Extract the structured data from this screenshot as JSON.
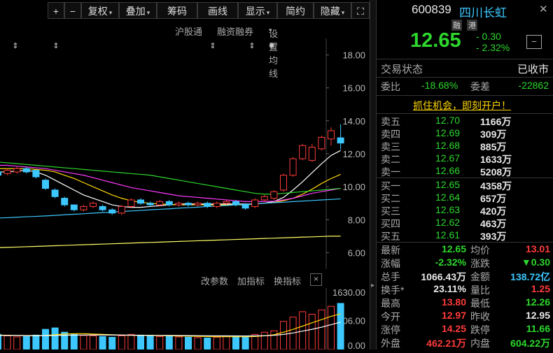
{
  "toolbar": {
    "plus": "+",
    "minus": "−",
    "fuquan": "复权",
    "diejia": "叠加",
    "chouma": "筹码",
    "huaxian": "画线",
    "xianshi": "显示",
    "jianyue": "简约",
    "yincang": "隐藏",
    "expand": "⛶"
  },
  "subbar": {
    "hugutong": "沪股通",
    "rongzi": "融资融券",
    "set_ma": "设置均线"
  },
  "price_axis": [
    "18.00",
    "16.00",
    "14.00",
    "12.00",
    "10.00",
    "8.00",
    "6.00"
  ],
  "volume_toolbar": {
    "change_params": "改参数",
    "add_indicator": "加指标",
    "switch_indicator": "换指标",
    "close": "×"
  },
  "volume_axis": [
    "1630.00",
    "806.00",
    "0.00"
  ],
  "quote": {
    "code": "600839",
    "name": "四川长虹",
    "badge_rong": "融",
    "badge_gang": "港",
    "price": "12.65",
    "change": "- 0.30",
    "change_pct": "- 2.32%",
    "minimize": "−"
  },
  "status": {
    "label": "交易状态",
    "value": "已收市"
  },
  "weibi": {
    "label": "委比",
    "value": "-18.68%",
    "cha_label": "委差",
    "cha_value": "-22862"
  },
  "promo": "抓住机会，即刻开户！",
  "asks": [
    {
      "label": "卖五",
      "price": "12.70",
      "vol": "1166万"
    },
    {
      "label": "卖四",
      "price": "12.69",
      "vol": "309万"
    },
    {
      "label": "卖三",
      "price": "12.68",
      "vol": "885万"
    },
    {
      "label": "卖二",
      "price": "12.67",
      "vol": "1633万"
    },
    {
      "label": "卖一",
      "price": "12.66",
      "vol": "5208万"
    }
  ],
  "bids": [
    {
      "label": "买一",
      "price": "12.65",
      "vol": "4358万"
    },
    {
      "label": "买二",
      "price": "12.64",
      "vol": "657万"
    },
    {
      "label": "买三",
      "price": "12.63",
      "vol": "420万"
    },
    {
      "label": "买四",
      "price": "12.62",
      "vol": "463万"
    },
    {
      "label": "买五",
      "price": "12.61",
      "vol": "393万"
    }
  ],
  "stats": [
    {
      "l1": "最新",
      "v1": "12.65",
      "c1": "green",
      "l2": "均价",
      "v2": "13.01",
      "c2": "red"
    },
    {
      "l1": "涨幅",
      "v1": "-2.32%",
      "c1": "green",
      "l2": "涨跌",
      "v2": "▼0.30",
      "c2": "green"
    },
    {
      "l1": "总手",
      "v1": "1066.43万",
      "c1": "white",
      "l2": "金额",
      "v2": "138.72亿",
      "c2": "cyan"
    },
    {
      "l1": "换手*",
      "v1": "23.11%",
      "c1": "white",
      "l2": "量比",
      "v2": "1.25",
      "c2": "red"
    },
    {
      "l1": "最高",
      "v1": "13.80",
      "c1": "red",
      "l2": "最低",
      "v2": "12.26",
      "c2": "green"
    },
    {
      "l1": "今开",
      "v1": "12.97",
      "c1": "red",
      "l2": "昨收",
      "v2": "12.95",
      "c2": "white"
    },
    {
      "l1": "涨停",
      "v1": "14.25",
      "c1": "red",
      "l2": "跌停",
      "v2": "11.66",
      "c2": "green"
    },
    {
      "l1": "外盘",
      "v1": "462.21万",
      "c1": "red",
      "l2": "内盘",
      "v2": "604.22万",
      "c2": "green"
    }
  ],
  "chart_data": {
    "type": "candlestick",
    "ylim": [
      5.0,
      19.0
    ],
    "candles": [
      {
        "o": 10.9,
        "c": 10.7,
        "h": 11.0,
        "l": 10.4
      },
      {
        "o": 10.8,
        "c": 11.0,
        "h": 11.1,
        "l": 10.7
      },
      {
        "o": 10.9,
        "c": 11.1,
        "h": 11.2,
        "l": 10.8
      },
      {
        "o": 11.1,
        "c": 10.9,
        "h": 11.2,
        "l": 10.8
      },
      {
        "o": 11.0,
        "c": 10.6,
        "h": 11.0,
        "l": 10.5
      },
      {
        "o": 10.4,
        "c": 9.9,
        "h": 10.5,
        "l": 9.8
      },
      {
        "o": 9.8,
        "c": 9.4,
        "h": 9.9,
        "l": 9.3
      },
      {
        "o": 9.3,
        "c": 8.9,
        "h": 9.4,
        "l": 8.8
      },
      {
        "o": 8.9,
        "c": 8.6,
        "h": 8.9,
        "l": 8.5
      },
      {
        "o": 8.6,
        "c": 8.8,
        "h": 8.9,
        "l": 8.5
      },
      {
        "o": 8.8,
        "c": 9.0,
        "h": 9.1,
        "l": 8.7
      },
      {
        "o": 8.8,
        "c": 8.6,
        "h": 8.9,
        "l": 8.5
      },
      {
        "o": 8.6,
        "c": 8.4,
        "h": 8.7,
        "l": 8.3
      },
      {
        "o": 8.4,
        "c": 8.8,
        "h": 8.9,
        "l": 8.3
      },
      {
        "o": 8.8,
        "c": 9.2,
        "h": 9.3,
        "l": 8.7
      },
      {
        "o": 9.2,
        "c": 9.0,
        "h": 9.3,
        "l": 8.9
      },
      {
        "o": 9.0,
        "c": 8.9,
        "h": 9.1,
        "l": 8.8
      },
      {
        "o": 8.9,
        "c": 9.1,
        "h": 9.2,
        "l": 8.8
      },
      {
        "o": 9.1,
        "c": 8.9,
        "h": 9.2,
        "l": 8.8
      },
      {
        "o": 8.9,
        "c": 9.0,
        "h": 9.1,
        "l": 8.8
      },
      {
        "o": 9.0,
        "c": 8.9,
        "h": 9.1,
        "l": 8.8
      },
      {
        "o": 8.9,
        "c": 9.0,
        "h": 9.1,
        "l": 8.8
      },
      {
        "o": 9.0,
        "c": 8.8,
        "h": 9.1,
        "l": 8.7
      },
      {
        "o": 8.8,
        "c": 9.0,
        "h": 9.1,
        "l": 8.7
      },
      {
        "o": 9.0,
        "c": 9.1,
        "h": 9.2,
        "l": 8.9
      },
      {
        "o": 9.1,
        "c": 8.9,
        "h": 9.2,
        "l": 8.8
      },
      {
        "o": 8.9,
        "c": 8.7,
        "h": 9.0,
        "l": 8.6
      },
      {
        "o": 8.8,
        "c": 9.2,
        "h": 9.3,
        "l": 8.7
      },
      {
        "o": 9.2,
        "c": 9.4,
        "h": 9.5,
        "l": 9.1
      },
      {
        "o": 9.3,
        "c": 9.7,
        "h": 9.8,
        "l": 9.2
      },
      {
        "o": 9.8,
        "c": 10.7,
        "h": 10.8,
        "l": 9.7
      },
      {
        "o": 10.7,
        "c": 11.7,
        "h": 11.8,
        "l": 10.6
      },
      {
        "o": 11.7,
        "c": 12.5,
        "h": 12.6,
        "l": 11.6
      },
      {
        "o": 11.6,
        "c": 12.4,
        "h": 12.6,
        "l": 11.5
      },
      {
        "o": 12.3,
        "c": 13.0,
        "h": 13.1,
        "l": 12.2
      },
      {
        "o": 12.9,
        "c": 13.4,
        "h": 13.6,
        "l": 12.5
      },
      {
        "o": 12.97,
        "c": 12.65,
        "h": 13.8,
        "l": 12.26
      }
    ],
    "ma": [
      {
        "color": "#ffffff",
        "values": [
          10.9,
          10.9,
          10.95,
          11.0,
          10.9,
          10.7,
          10.4,
          10.1,
          9.8,
          9.5,
          9.3,
          9.1,
          8.9,
          8.8,
          8.75,
          8.75,
          8.8,
          8.85,
          8.9,
          8.95,
          8.95,
          8.95,
          8.95,
          8.95,
          8.95,
          8.95,
          8.95,
          8.95,
          9.0,
          9.1,
          9.35,
          9.8,
          10.3,
          10.85,
          11.4,
          11.9,
          12.2
        ]
      },
      {
        "color": "#ffd700",
        "values": [
          11.1,
          11.1,
          11.1,
          11.1,
          11.05,
          11.0,
          10.9,
          10.7,
          10.5,
          10.25,
          10.0,
          9.75,
          9.5,
          9.3,
          9.15,
          9.05,
          9.0,
          8.95,
          8.92,
          8.9,
          8.9,
          8.9,
          8.9,
          8.9,
          8.9,
          8.9,
          8.9,
          8.95,
          9.0,
          9.05,
          9.15,
          9.3,
          9.55,
          9.85,
          10.2,
          10.5,
          10.75
        ]
      },
      {
        "color": "#ff3bff",
        "values": [
          11.3,
          11.3,
          11.25,
          11.2,
          11.15,
          11.1,
          11.0,
          10.9,
          10.8,
          10.7,
          10.55,
          10.4,
          10.25,
          10.1,
          9.95,
          9.85,
          9.75,
          9.65,
          9.55,
          9.45,
          9.4,
          9.35,
          9.3,
          9.25,
          9.2,
          9.15,
          9.1,
          9.1,
          9.1,
          9.12,
          9.2,
          9.3,
          9.45,
          9.6,
          9.7,
          9.8,
          9.9
        ]
      },
      {
        "color": "#2dd82d",
        "values": [
          11.5,
          11.45,
          11.4,
          11.35,
          11.3,
          11.25,
          11.2,
          11.15,
          11.1,
          11.05,
          11.0,
          10.95,
          10.9,
          10.85,
          10.8,
          10.75,
          10.7,
          10.6,
          10.5,
          10.4,
          10.3,
          10.2,
          10.1,
          10.0,
          9.9,
          9.8,
          9.7,
          9.6,
          9.55,
          9.55,
          9.6,
          9.65,
          9.7,
          9.75,
          9.8,
          9.85,
          9.9
        ]
      },
      {
        "color": "#3cc8ff",
        "values": [
          8.1,
          8.12,
          8.15,
          8.18,
          8.2,
          8.23,
          8.26,
          8.3,
          8.33,
          8.36,
          8.4,
          8.43,
          8.46,
          8.5,
          8.53,
          8.56,
          8.6,
          8.63,
          8.66,
          8.7,
          8.73,
          8.76,
          8.8,
          8.83,
          8.86,
          8.9,
          8.93,
          8.96,
          9.0,
          9.03,
          9.06,
          9.1,
          9.13,
          9.16,
          9.2,
          9.23,
          9.26
        ]
      },
      {
        "color": "#ffff66",
        "values": [
          6.3,
          6.32,
          6.34,
          6.36,
          6.38,
          6.4,
          6.42,
          6.44,
          6.46,
          6.48,
          6.5,
          6.52,
          6.54,
          6.56,
          6.58,
          6.6,
          6.62,
          6.64,
          6.66,
          6.68,
          6.7,
          6.72,
          6.74,
          6.76,
          6.78,
          6.8,
          6.82,
          6.84,
          6.86,
          6.88,
          6.9,
          6.92,
          6.94,
          6.96,
          6.98,
          7.0,
          7.0
        ]
      }
    ],
    "volume": [
      420,
      380,
      350,
      360,
      400,
      560,
      600,
      480,
      420,
      390,
      380,
      360,
      340,
      380,
      420,
      400,
      380,
      360,
      370,
      350,
      340,
      330,
      320,
      340,
      360,
      380,
      350,
      420,
      480,
      520,
      780,
      900,
      1050,
      980,
      1100,
      1200,
      1280
    ],
    "volume_ma": [
      {
        "color": "#ffd700",
        "values": [
          400,
          395,
          390,
          385,
          380,
          390,
          410,
          430,
          440,
          440,
          430,
          420,
          410,
          400,
          395,
          390,
          390,
          385,
          380,
          375,
          370,
          365,
          360,
          355,
          355,
          355,
          355,
          360,
          380,
          410,
          480,
          560,
          650,
          740,
          830,
          920,
          990
        ]
      },
      {
        "color": "#ffffff",
        "values": [
          390,
          390,
          390,
          388,
          386,
          386,
          390,
          395,
          400,
          402,
          403,
          403,
          402,
          400,
          398,
          396,
          394,
          392,
          390,
          388,
          386,
          384,
          382,
          380,
          378,
          377,
          376,
          378,
          384,
          394,
          420,
          460,
          510,
          560,
          620,
          690,
          760
        ]
      }
    ],
    "vol_ylim": [
      0,
      1630
    ]
  }
}
